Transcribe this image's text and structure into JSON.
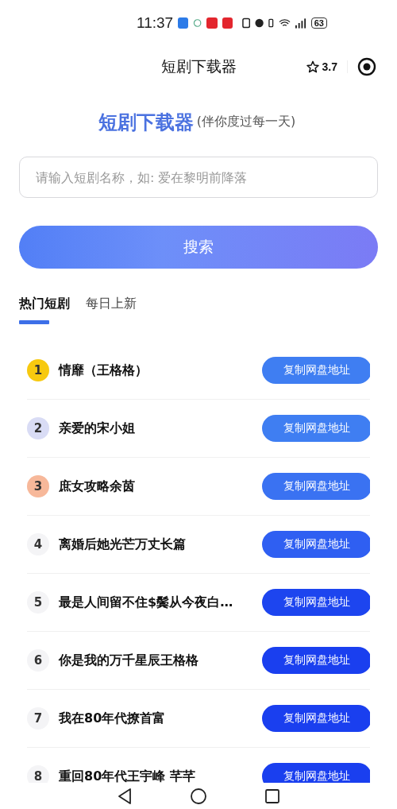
{
  "status_bar": {
    "time": "11:37",
    "battery": "63"
  },
  "nav_bar": {
    "title": "短剧下载器",
    "rating": "3.7"
  },
  "header": {
    "title": "短剧下载器",
    "subtitle": "(伴你度过每一天)"
  },
  "search": {
    "placeholder": "请输入短剧名称，如: 爱在黎明前降落",
    "button": "搜索"
  },
  "tabs": [
    {
      "label": "热门短剧",
      "selected": true
    },
    {
      "label": "每日上新",
      "selected": false
    }
  ],
  "rows": [
    {
      "rank": {
        "label": "1",
        "color": "#f7c90f"
      },
      "title": "情靡（王格格）",
      "button": {
        "label": "复制网盘地址",
        "color": "#3f7ef2"
      }
    },
    {
      "rank": {
        "label": "2",
        "color": "#d9dcf5"
      },
      "title": "亲爱的宋小姐",
      "button": {
        "label": "复制网盘地址",
        "color": "#3f7ef2"
      }
    },
    {
      "rank": {
        "label": "3",
        "color": "#f7b89a"
      },
      "title": "庶女攻略余茵",
      "button": {
        "label": "复制网盘地址",
        "color": "#3a72f2"
      }
    },
    {
      "rank": {
        "label": "4",
        "color": "#f4f4f6"
      },
      "title": "离婚后她光芒万丈长篇",
      "button": {
        "label": "复制网盘地址",
        "color": "#2f5ff2"
      }
    },
    {
      "rank": {
        "label": "5",
        "color": "#f4f4f6"
      },
      "title": "最是人间留不住$鬓从今夜白…",
      "button": {
        "label": "复制网盘地址",
        "color": "#1d45ef"
      }
    },
    {
      "rank": {
        "label": "6",
        "color": "#f4f4f6"
      },
      "title": "你是我的万千星辰王格格",
      "button": {
        "label": "复制网盘地址",
        "color": "#1a3fef"
      }
    },
    {
      "rank": {
        "label": "7",
        "color": "#f4f4f6"
      },
      "title": "我在80年代撩首富",
      "button": {
        "label": "复制网盘地址",
        "color": "#1a3fef"
      }
    },
    {
      "rank": {
        "label": "8",
        "color": "#f4f4f6"
      },
      "title": "重回80年代王宇峰 芊芊",
      "button": {
        "label": "复制网盘地址",
        "color": "#1a3fef"
      }
    }
  ]
}
